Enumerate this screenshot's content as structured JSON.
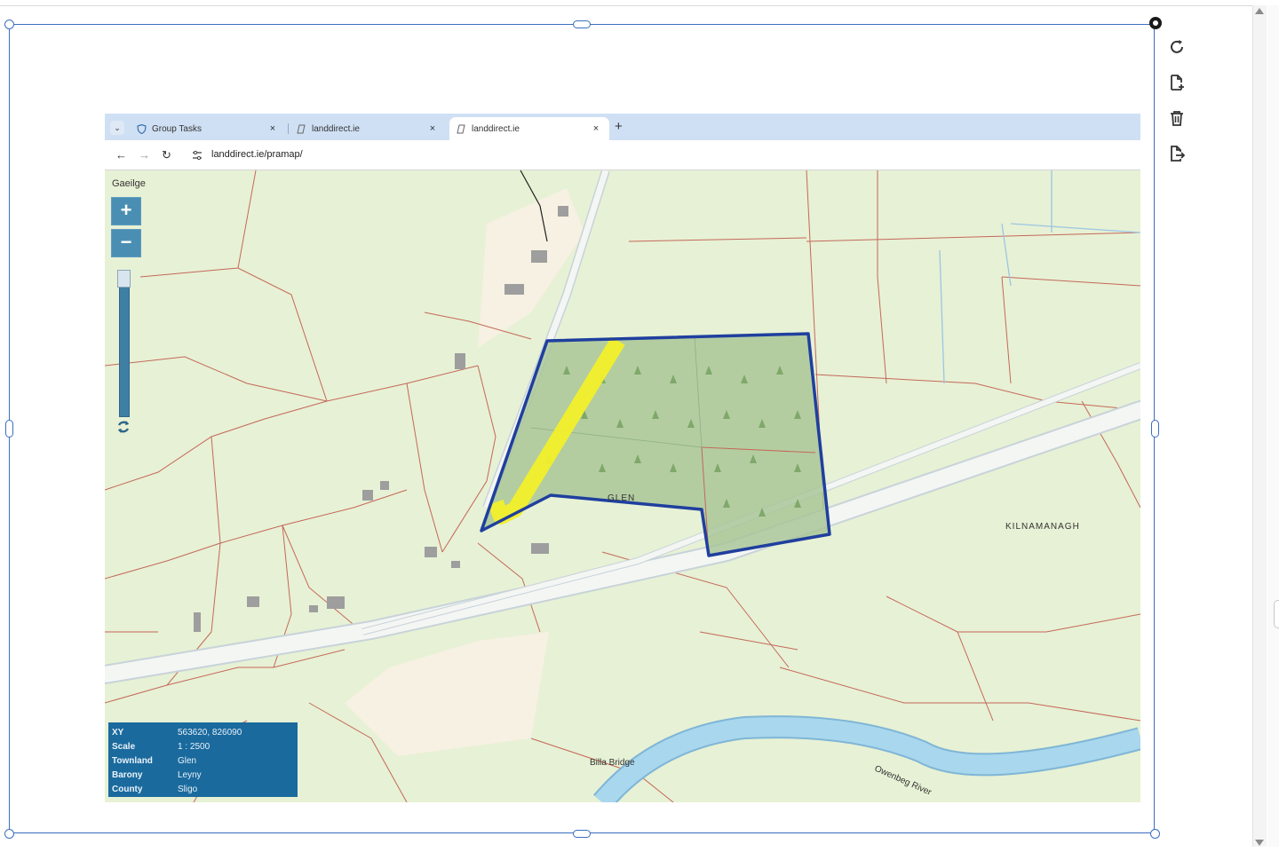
{
  "browser": {
    "tabs": [
      {
        "title": "Group Tasks",
        "close": "×",
        "active": false
      },
      {
        "title": "landdirect.ie",
        "close": "×",
        "active": false
      },
      {
        "title": "landdirect.ie",
        "close": "×",
        "active": true
      }
    ],
    "tab_menu": "⌄",
    "new_tab": "+",
    "nav": {
      "back": "←",
      "forward": "→",
      "reload": "↻"
    },
    "url": "landdirect.ie/pramap/"
  },
  "map": {
    "language_link": "Gaeilge",
    "zoom_in": "+",
    "zoom_out": "−",
    "zoom_level": 0.0,
    "labels": {
      "parcel_townland": "GLEN",
      "neighbour_townland": "KILNAMANAGH",
      "bridge": "Billa Bridge",
      "river": "Owenbeg River"
    },
    "info": [
      {
        "key": "XY",
        "value": "563620, 826090"
      },
      {
        "key": "Scale",
        "value": "1 : 2500"
      },
      {
        "key": "Townland",
        "value": "Glen"
      },
      {
        "key": "Barony",
        "value": "Leyny"
      },
      {
        "key": "County",
        "value": "Sligo"
      }
    ],
    "colors": {
      "land": "#e7f1d5",
      "boundary": "#c4685a",
      "road": "#f4f6f4",
      "parcel_outline": "#1f3f9e",
      "parcel_fill": "#a6c494",
      "path": "#f2ef2a",
      "water": "#a9d7ee",
      "panel": "#1a6a9e"
    }
  },
  "editor_tools": {
    "items": [
      {
        "name": "rotate-image-icon"
      },
      {
        "name": "add-page-icon"
      },
      {
        "name": "delete-icon"
      },
      {
        "name": "export-page-icon"
      }
    ]
  }
}
